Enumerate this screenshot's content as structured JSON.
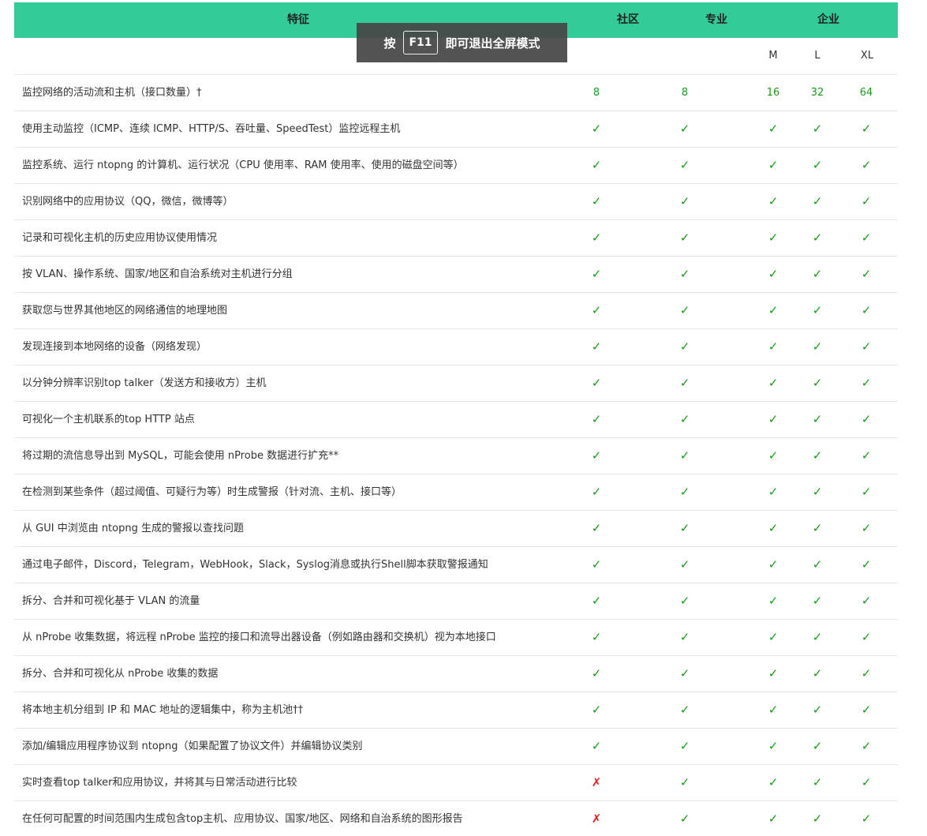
{
  "header": {
    "feature": "特征",
    "community": "社区",
    "pro": "专业",
    "enterprise": "企业"
  },
  "subheader": {
    "m": "M",
    "l": "L",
    "xl": "XL"
  },
  "toast": {
    "press": "按",
    "key": "F11",
    "message": "即可退出全屏模式"
  },
  "symbols": {
    "yes": "✓",
    "no": "✗"
  },
  "colors": {
    "header_bg": "#33cc99",
    "check": "#1a9a1a",
    "cross": "#e02020"
  },
  "rows": [
    {
      "feature": "监控网络的活动流和主机（接口数量）†",
      "values": [
        "8",
        "8",
        "16",
        "32",
        "64"
      ]
    },
    {
      "feature": "使用主动监控（ICMP、连续 ICMP、HTTP/S、吞吐量、SpeedTest）监控远程主机",
      "values": [
        "✓",
        "✓",
        "✓",
        "✓",
        "✓"
      ]
    },
    {
      "feature": "监控系统、运行 ntopng 的计算机、运行状况（CPU 使用率、RAM 使用率、使用的磁盘空间等）",
      "values": [
        "✓",
        "✓",
        "✓",
        "✓",
        "✓"
      ]
    },
    {
      "feature": "识别网络中的应用协议（QQ，微信，微博等）",
      "values": [
        "✓",
        "✓",
        "✓",
        "✓",
        "✓"
      ]
    },
    {
      "feature": "记录和可视化主机的历史应用协议使用情况",
      "values": [
        "✓",
        "✓",
        "✓",
        "✓",
        "✓"
      ]
    },
    {
      "feature": "按 VLAN、操作系统、国家/地区和自治系统对主机进行分组",
      "values": [
        "✓",
        "✓",
        "✓",
        "✓",
        "✓"
      ]
    },
    {
      "feature": "获取您与世界其他地区的网络通信的地理地图",
      "values": [
        "✓",
        "✓",
        "✓",
        "✓",
        "✓"
      ]
    },
    {
      "feature": "发现连接到本地网络的设备（网络发现）",
      "values": [
        "✓",
        "✓",
        "✓",
        "✓",
        "✓"
      ]
    },
    {
      "feature": "以分钟分辨率识别top talker（发送方和接收方）主机",
      "values": [
        "✓",
        "✓",
        "✓",
        "✓",
        "✓"
      ]
    },
    {
      "feature": "可视化一个主机联系的top HTTP 站点",
      "values": [
        "✓",
        "✓",
        "✓",
        "✓",
        "✓"
      ]
    },
    {
      "feature": "将过期的流信息导出到 MySQL，可能会使用 nProbe 数据进行扩充**",
      "values": [
        "✓",
        "✓",
        "✓",
        "✓",
        "✓"
      ]
    },
    {
      "feature": "在检测到某些条件（超过阈值、可疑行为等）时生成警报（针对流、主机、接口等）",
      "values": [
        "✓",
        "✓",
        "✓",
        "✓",
        "✓"
      ]
    },
    {
      "feature": "从 GUI 中浏览由 ntopng 生成的警报以查找问题",
      "values": [
        "✓",
        "✓",
        "✓",
        "✓",
        "✓"
      ]
    },
    {
      "feature": "通过电子邮件，Discord，Telegram，WebHook，Slack，Syslog消息或执行Shell脚本获取警报通知",
      "values": [
        "✓",
        "✓",
        "✓",
        "✓",
        "✓"
      ]
    },
    {
      "feature": "拆分、合并和可视化基于 VLAN 的流量",
      "values": [
        "✓",
        "✓",
        "✓",
        "✓",
        "✓"
      ]
    },
    {
      "feature": "从 nProbe 收集数据，将远程 nProbe 监控的接口和流导出器设备（例如路由器和交换机）视为本地接口",
      "values": [
        "✓",
        "✓",
        "✓",
        "✓",
        "✓"
      ]
    },
    {
      "feature": "拆分、合并和可视化从 nProbe 收集的数据",
      "values": [
        "✓",
        "✓",
        "✓",
        "✓",
        "✓"
      ]
    },
    {
      "feature": "将本地主机分组到 IP 和 MAC 地址的逻辑集中，称为主机池††",
      "values": [
        "✓",
        "✓",
        "✓",
        "✓",
        "✓"
      ]
    },
    {
      "feature": "添加/编辑应用程序协议到 ntopng（如果配置了协议文件）并编辑协议类别",
      "values": [
        "✓",
        "✓",
        "✓",
        "✓",
        "✓"
      ]
    },
    {
      "feature": "实时查看top talker和应用协议，并将其与日常活动进行比较",
      "values": [
        "✗",
        "✓",
        "✓",
        "✓",
        "✓"
      ]
    },
    {
      "feature": "在任何可配置的时间范围内生成包含top主机、应用协议、国家/地区、网络和自治系统的图形报告",
      "values": [
        "✗",
        "✓",
        "✓",
        "✓",
        "✓"
      ]
    }
  ]
}
